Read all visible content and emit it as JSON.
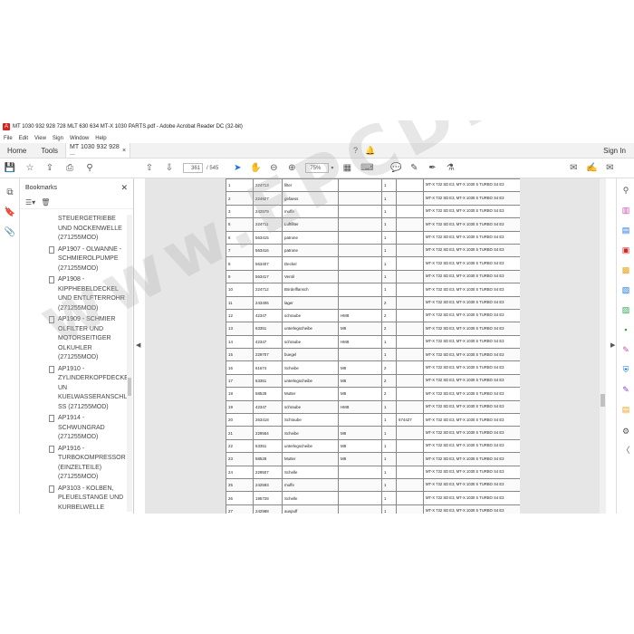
{
  "window": {
    "title": "MT 1030 932 928 728 MLT 630 634 MT-X 1030 PARTS.pdf - Adobe Acrobat Reader DC (32-bit)"
  },
  "menu": [
    "File",
    "Edit",
    "View",
    "Sign",
    "Window",
    "Help"
  ],
  "tabs": {
    "home": "Home",
    "tools": "Tools",
    "document": "MT 1030 932 928 ...",
    "close": "×",
    "sign_in": "Sign In"
  },
  "toolbar": {
    "current_page": "361",
    "page_total": "/ 545",
    "zoom": "75%"
  },
  "bookmarks": {
    "title": "Bookmarks",
    "items": [
      "STEUERGETRIEBE UND NOCKENWELLE (271255MOD)",
      "AP1907 - OLWANNE - SCHMIEROLPUMPE (271255MOD)",
      "AP1908 - KIPPHEBELDECKEL UND ENTLFTERROHR (271255MOD)",
      "AP1909 - SCHMIER OLFILTER UND MOTORSEITIGER OLKUHLER (271255MOD)",
      "AP1910 - ZYLINDERKOPFDECKEL UN KUELWASSERANSCHLU SS (271255MOD)",
      "AP1914 - SCHWUNGRAD (271255MOD)",
      "AP1916 - TURBOKOMPRESSOR (EINZELTEILE) (271255MOD)",
      "AP3103 - KOLBEN, PLEUELSTANGE UND KURBELWELLE (271255MOD)"
    ]
  },
  "table": {
    "rows": [
      {
        "n": "1",
        "ref": "224713",
        "name": "filter",
        "size": "",
        "qty": "1",
        "note": "",
        "model": "MT-X 732 SD E3, MT-X 1030 S TURBO S4 E3"
      },
      {
        "n": "2",
        "ref": "224927",
        "name": "gefaess",
        "size": "",
        "qty": "1",
        "note": "",
        "model": "MT-X 732 SD E3, MT-X 1030 S TURBO S4 E3"
      },
      {
        "n": "3",
        "ref": "242579",
        "name": "muffe",
        "size": "",
        "qty": "1",
        "note": "",
        "model": "MT-X 732 SD E3, MT-X 1030 S TURBO S4 E3"
      },
      {
        "n": "5",
        "ref": "224711",
        "name": "Luftfilter",
        "size": "",
        "qty": "1",
        "note": "",
        "model": "MT-X 732 SD E3, MT-X 1030 S TURBO S4 E3"
      },
      {
        "n": "6",
        "ref": "563415",
        "name": "patrone",
        "size": "",
        "qty": "1",
        "note": "",
        "model": "MT-X 732 SD E3, MT-X 1030 S TURBO S4 E3"
      },
      {
        "n": "7",
        "ref": "563416",
        "name": "patrone",
        "size": "",
        "qty": "1",
        "note": "",
        "model": "MT-X 732 SD E3, MT-X 1030 S TURBO S4 E3"
      },
      {
        "n": "8",
        "ref": "563407",
        "name": "Deckel",
        "size": "",
        "qty": "1",
        "note": "",
        "model": "MT-X 732 SD E3, MT-X 1030 S TURBO S4 E3"
      },
      {
        "n": "9",
        "ref": "563417",
        "name": "Ventil",
        "size": "",
        "qty": "1",
        "note": "",
        "model": "MT-X 732 SD E3, MT-X 1030 S TURBO S4 E3"
      },
      {
        "n": "10",
        "ref": "224712",
        "name": "Bördelflansch",
        "size": "",
        "qty": "1",
        "note": "",
        "model": "MT-X 732 SD E3, MT-X 1030 S TURBO S4 E3"
      },
      {
        "n": "11",
        "ref": "243406",
        "name": "lager",
        "size": "",
        "qty": "2",
        "note": "",
        "model": "MT-X 732 SD E3, MT-X 1030 S TURBO S4 E3"
      },
      {
        "n": "12",
        "ref": "42347",
        "name": "schraube",
        "size": "HM8",
        "qty": "2",
        "note": "",
        "model": "MT-X 732 SD E3, MT-X 1030 S TURBO S4 E3"
      },
      {
        "n": "13",
        "ref": "63351",
        "name": "unterlegscheibe",
        "size": "M8",
        "qty": "2",
        "note": "",
        "model": "MT-X 732 SD E3, MT-X 1030 S TURBO S4 E3"
      },
      {
        "n": "14",
        "ref": "42347",
        "name": "schraube",
        "size": "HM8",
        "qty": "1",
        "note": "",
        "model": "MT-X 732 SD E3, MT-X 1030 S TURBO S4 E3"
      },
      {
        "n": "15",
        "ref": "229707",
        "name": "buegel",
        "size": "",
        "qty": "1",
        "note": "",
        "model": "MT-X 732 SD E3, MT-X 1030 S TURBO S4 E3"
      },
      {
        "n": "16",
        "ref": "61674",
        "name": "Scheibe",
        "size": "M8",
        "qty": "2",
        "note": "",
        "model": "MT-X 732 SD E3, MT-X 1030 S TURBO S4 E3"
      },
      {
        "n": "17",
        "ref": "63351",
        "name": "unterlegscheibe",
        "size": "M8",
        "qty": "2",
        "note": "",
        "model": "MT-X 732 SD E3, MT-X 1030 S TURBO S4 E3"
      },
      {
        "n": "18",
        "ref": "58528",
        "name": "Mutter",
        "size": "M8",
        "qty": "2",
        "note": "",
        "model": "MT-X 732 SD E3, MT-X 1030 S TURBO S4 E3"
      },
      {
        "n": "19",
        "ref": "42347",
        "name": "schraube",
        "size": "HM8",
        "qty": "1",
        "note": "",
        "model": "MT-X 732 SD E3, MT-X 1030 S TURBO S4 E3"
      },
      {
        "n": "20",
        "ref": "263418",
        "name": "Schraube",
        "size": "",
        "qty": "1",
        "note": "674427",
        "model": "MT-X 732 SD E3, MT-X 1030 S TURBO S4 E3"
      },
      {
        "n": "21",
        "ref": "229564",
        "name": "Scheibe",
        "size": "M8",
        "qty": "1",
        "note": "",
        "model": "MT-X 732 SD E3, MT-X 1030 S TURBO S4 E3"
      },
      {
        "n": "22",
        "ref": "63351",
        "name": "unterlegscheibe",
        "size": "M8",
        "qty": "1",
        "note": "",
        "model": "MT-X 732 SD E3, MT-X 1030 S TURBO S4 E3"
      },
      {
        "n": "23",
        "ref": "58528",
        "name": "Mutter",
        "size": "M8",
        "qty": "1",
        "note": "",
        "model": "MT-X 732 SD E3, MT-X 1030 S TURBO S4 E3"
      },
      {
        "n": "24",
        "ref": "229507",
        "name": "Schelle",
        "size": "",
        "qty": "1",
        "note": "",
        "model": "MT-X 732 SD E3, MT-X 1030 S TURBO S4 E3"
      },
      {
        "n": "25",
        "ref": "242593",
        "name": "muffe",
        "size": "",
        "qty": "1",
        "note": "",
        "model": "MT-X 732 SD E3, MT-X 1030 S TURBO S4 E3"
      },
      {
        "n": "26",
        "ref": "195728",
        "name": "Schelle",
        "size": "",
        "qty": "1",
        "note": "",
        "model": "MT-X 732 SD E3, MT-X 1030 S TURBO S4 E3"
      },
      {
        "n": "27",
        "ref": "242988",
        "name": "auspuff",
        "size": "",
        "qty": "1",
        "note": "",
        "model": "MT-X 732 SD E3, MT-X 1030 S TURBO S4 E3"
      }
    ]
  },
  "watermark": "www.EPCDEPOT.com",
  "colors": {
    "acrobat_red": "#d7231f",
    "accent_blue": "#1473e6",
    "doc_background": "#e6e6e6"
  }
}
